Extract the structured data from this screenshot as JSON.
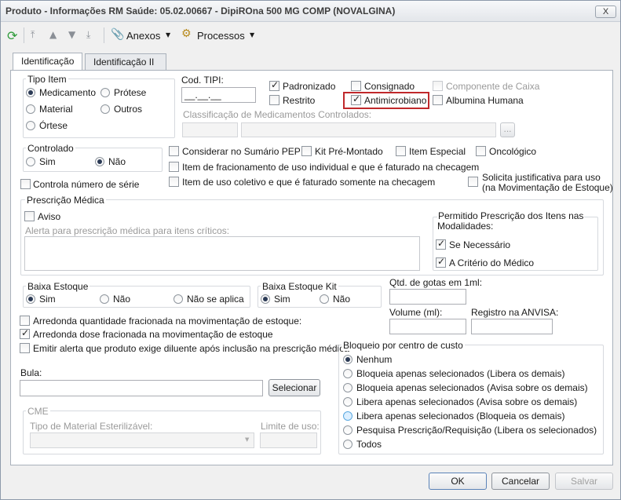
{
  "window": {
    "title": "Produto - Informações RM Saúde: 05.02.00667 - DipiROna 500 MG COMP (NOVALGINA)",
    "close": "X"
  },
  "toolbar": {
    "anexos": "Anexos",
    "processos": "Processos"
  },
  "tabs": [
    "Identificação",
    "Identificação II"
  ],
  "tipo_item": {
    "legend": "Tipo Item",
    "options": [
      "Medicamento",
      "Prótese",
      "Material",
      "Outros",
      "Órtese"
    ],
    "selected": "Medicamento"
  },
  "cod_tipi": {
    "label": "Cod. TIPI:",
    "value": "__.__.__"
  },
  "flags": {
    "padronizado": "Padronizado",
    "consignado": "Consignado",
    "componente_caixa": "Componente de Caixa",
    "restrito": "Restrito",
    "antimicrobiano": "Antimicrobiano",
    "albumina": "Albumina Humana"
  },
  "classificacao": {
    "label": "Classificação de Medicamentos Controlados:",
    "browse": "..."
  },
  "controlado": {
    "legend": "Controlado",
    "sim": "Sim",
    "nao": "Não",
    "selected": "Não"
  },
  "checks": {
    "sumario_pep": "Considerar no Sumário PEP",
    "kit": "Kit Pré-Montado",
    "item_especial": "Item Especial",
    "oncologico": "Oncológico",
    "fracionamento": "Item de fracionamento de uso individual e que é faturado na checagem",
    "uso_coletivo": "Item de uso coletivo e que é faturado somente na checagem",
    "justificativa": "Solicita justificativa para uso\n(na Movimentação de Estoque)",
    "justificativa_1": "Solicita justificativa para uso",
    "justificativa_2": "(na Movimentação de Estoque)",
    "numero_serie": "Controla número de série"
  },
  "prescricao": {
    "legend": "Prescrição Médica",
    "aviso": "Aviso",
    "alerta_label": "Alerta para prescrição médica para itens críticos:",
    "modalidades_1": "Permitido Prescrição dos Itens nas",
    "modalidades_2": "Modalidades:",
    "se_necessario": "Se Necessário",
    "a_criterio": "A Critério do Médico"
  },
  "baixa_estoque": {
    "legend": "Baixa Estoque",
    "sim": "Sim",
    "nao": "Não",
    "nao_aplica": "Não se aplica"
  },
  "baixa_kit": {
    "legend": "Baixa Estoque Kit",
    "sim": "Sim",
    "nao": "Não"
  },
  "medidas": {
    "gotas": "Qtd. de gotas em 1ml:",
    "volume": "Volume (ml):",
    "anvisa": "Registro na ANVISA:"
  },
  "arredonda": {
    "fracionada": "Arredonda quantidade fracionada na movimentação de estoque:",
    "dose": "Arredonda dose fracionada na movimentação de estoque",
    "diluente": "Emitir alerta que produto exige diluente após inclusão na prescrição médica"
  },
  "bula": {
    "label": "Bula:",
    "button": "Selecionar"
  },
  "cme": {
    "legend": "CME",
    "tipo": "Tipo de Material Esterilizável:",
    "limite": "Limite de uso:"
  },
  "bloqueio": {
    "legend": "Bloqueio por centro de custo",
    "options": [
      "Nenhum",
      "Bloqueia apenas selecionados (Libera os demais)",
      "Bloqueia apenas selecionados (Avisa sobre os demais)",
      "Libera apenas selecionados (Avisa sobre os demais)",
      "Libera apenas selecionados (Bloqueia os demais)",
      "Pesquisa Prescrição/Requisição (Libera os selecionados)",
      "Todos"
    ],
    "selected": "Nenhum"
  },
  "footer": {
    "ok": "OK",
    "cancelar": "Cancelar",
    "salvar": "Salvar"
  },
  "colors": {
    "highlight_border": "#c0282b",
    "accent": "#2b3a55"
  }
}
